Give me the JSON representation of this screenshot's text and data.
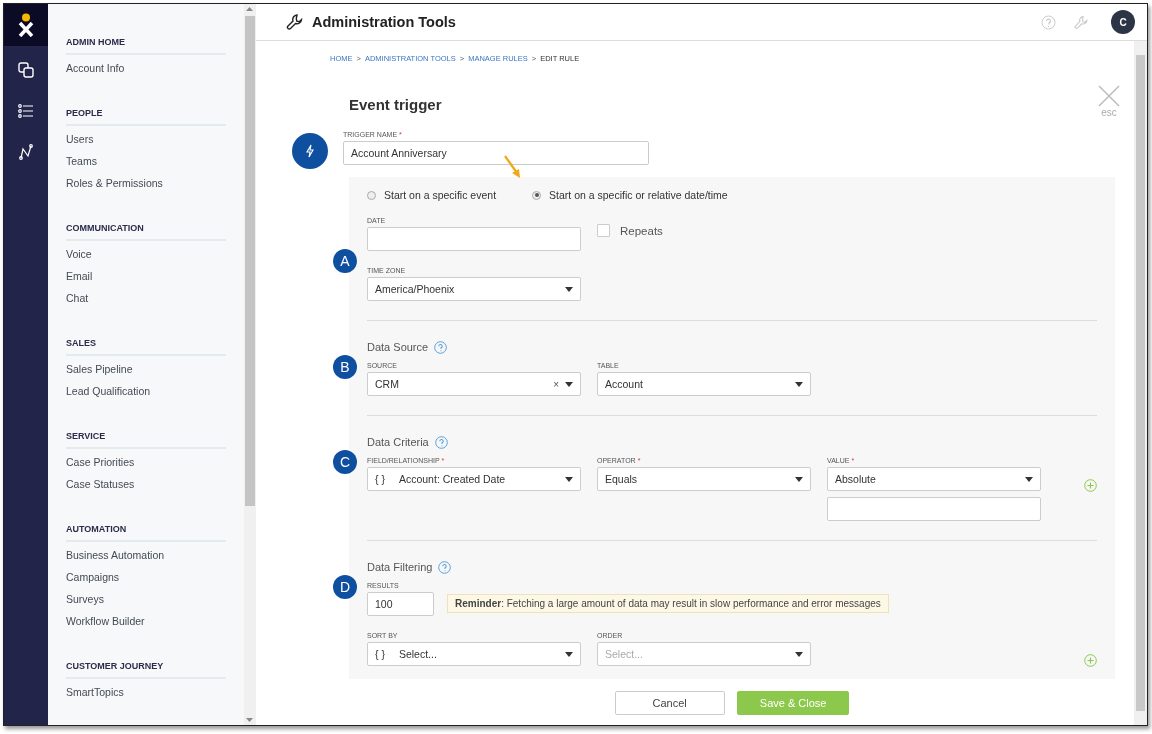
{
  "sidebar": {
    "sections": [
      {
        "heading": "ADMIN HOME",
        "items": [
          "Account Info"
        ]
      },
      {
        "heading": "PEOPLE",
        "items": [
          "Users",
          "Teams",
          "Roles & Permissions"
        ]
      },
      {
        "heading": "COMMUNICATION",
        "items": [
          "Voice",
          "Email",
          "Chat"
        ]
      },
      {
        "heading": "SALES",
        "items": [
          "Sales Pipeline",
          "Lead Qualification"
        ]
      },
      {
        "heading": "SERVICE",
        "items": [
          "Case Priorities",
          "Case Statuses"
        ]
      },
      {
        "heading": "AUTOMATION",
        "items": [
          "Business Automation",
          "Campaigns",
          "Surveys",
          "Workflow Builder"
        ]
      },
      {
        "heading": "CUSTOMER JOURNEY",
        "items": [
          "SmartTopics"
        ]
      }
    ]
  },
  "header": {
    "title": "Administration Tools",
    "avatar": "C"
  },
  "breadcrumb": {
    "items": [
      {
        "label": "HOME",
        "current": false
      },
      {
        "label": "ADMINISTRATION TOOLS",
        "current": false
      },
      {
        "label": "MANAGE RULES",
        "current": false
      },
      {
        "label": "EDIT RULE",
        "current": true
      }
    ],
    "separators": [
      ">",
      ">",
      ">"
    ]
  },
  "close": {
    "label": "esc"
  },
  "form": {
    "title": "Event trigger",
    "trigger_name": {
      "label": "TRIGGER NAME",
      "required_mark": "*",
      "value": "Account Anniversary"
    },
    "start_options": [
      {
        "label": "Start on a specific event",
        "selected": false
      },
      {
        "label": "Start on a specific or relative date/time",
        "selected": true
      }
    ],
    "sections": [
      {
        "badge": "A",
        "rows": [
          {
            "fields": [
              {
                "kind": "input",
                "label": "DATE"
              },
              {
                "kind": "checkbox",
                "label": "Repeats",
                "checked": false
              }
            ]
          },
          {
            "fields": [
              {
                "kind": "select",
                "label": "TIME ZONE",
                "value": "America/Phoenix"
              }
            ]
          }
        ]
      },
      {
        "badge": "B",
        "title": "Data Source",
        "rows": [
          {
            "fields": [
              {
                "kind": "select",
                "label": "SOURCE",
                "value": "CRM",
                "clear": "×"
              },
              {
                "kind": "select",
                "label": "TABLE",
                "value": "Account"
              }
            ]
          }
        ]
      },
      {
        "badge": "C",
        "title": "Data Criteria",
        "rows": [
          {
            "add": true,
            "fields": [
              {
                "kind": "select",
                "label": "FIELD/RELATIONSHIP",
                "required_mark": "*",
                "prefix": "{ }",
                "value": "Account: Created Date"
              },
              {
                "kind": "select",
                "label": "OPERATOR",
                "required_mark": "*",
                "value": "Equals"
              },
              {
                "kind": "select",
                "label": "VALUE",
                "required_mark": "*",
                "value": "Absolute",
                "extra_input": true
              }
            ]
          }
        ]
      },
      {
        "badge": "D",
        "title": "Data Filtering",
        "rows": [
          {
            "fields": [
              {
                "kind": "short_input",
                "label": "RESULTS",
                "value": "100"
              },
              {
                "kind": "reminder",
                "text": "**Reminder**: Fetching a large amount of data may result in slow performance and error messages"
              }
            ]
          },
          {
            "add": true,
            "fields": [
              {
                "kind": "select",
                "label": "SORT BY",
                "prefix": "{ }",
                "value": "Select..."
              },
              {
                "kind": "select",
                "label": "ORDER",
                "placeholder": "Select..."
              }
            ]
          }
        ]
      }
    ],
    "buttons": [
      {
        "label": "Cancel",
        "kind": "secondary"
      },
      {
        "label": "Save & Close",
        "kind": "primary"
      }
    ]
  }
}
